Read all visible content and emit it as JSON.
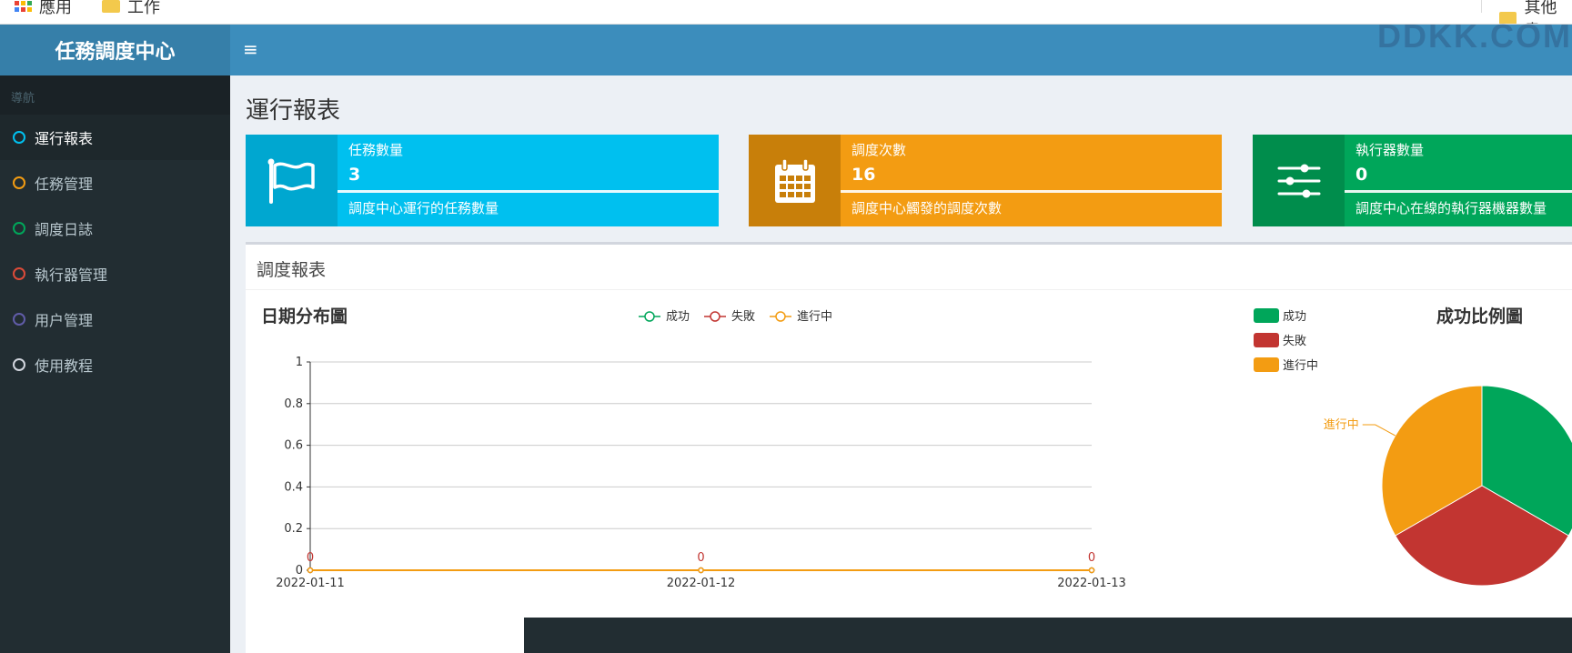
{
  "bookmarks": {
    "apps_label": "應用",
    "work_label": "工作",
    "other_label": "其他書"
  },
  "header": {
    "logo": "任務調度中心",
    "toggle_icon": "≡",
    "watermark": "DDKK.COM"
  },
  "sidebar": {
    "header": "導航",
    "items": [
      {
        "label": "運行報表",
        "color": "#00c0ef"
      },
      {
        "label": "任務管理",
        "color": "#f39c12"
      },
      {
        "label": "調度日誌",
        "color": "#00a65a"
      },
      {
        "label": "執行器管理",
        "color": "#dd4b39"
      },
      {
        "label": "用户管理",
        "color": "#605ca8"
      },
      {
        "label": "使用教程",
        "color": "#d2d6de"
      }
    ]
  },
  "page": {
    "title": "運行報表"
  },
  "info_boxes": [
    {
      "label": "任務數量",
      "number": "3",
      "desc": "調度中心運行的任務數量",
      "icon": "flag-icon",
      "color": "#00c0ef",
      "icon_bg": "#00a7d0"
    },
    {
      "label": "調度次數",
      "number": "16",
      "desc": "調度中心觸發的調度次數",
      "icon": "calendar-icon",
      "color": "#f39c12",
      "icon_bg": "#c87f0a"
    },
    {
      "label": "執行器數量",
      "number": "0",
      "desc": "調度中心在線的執行器機器數量",
      "icon": "sliders-icon",
      "color": "#00a65a",
      "icon_bg": "#008d4c"
    }
  ],
  "report": {
    "box_title": "調度報表"
  },
  "chart_data": [
    {
      "type": "line",
      "title": "日期分布圖",
      "x": [
        "2022-01-11",
        "2022-01-12",
        "2022-01-13"
      ],
      "series": [
        {
          "name": "成功",
          "values": [
            0,
            0,
            0
          ],
          "color": "#00a65a"
        },
        {
          "name": "失敗",
          "values": [
            0,
            0,
            0
          ],
          "color": "#c23531"
        },
        {
          "name": "進行中",
          "values": [
            0,
            0,
            0
          ],
          "color": "#f39c12"
        }
      ],
      "ylim": [
        0,
        1
      ],
      "yticks": [
        "0",
        "0.2",
        "0.4",
        "0.6",
        "0.8",
        "1"
      ],
      "data_labels": [
        "0",
        "0",
        "0"
      ],
      "grid": true,
      "legend": "top-center"
    },
    {
      "type": "pie",
      "title": "成功比例圖",
      "categories": [
        "成功",
        "失敗",
        "進行中"
      ],
      "values": [
        1,
        1,
        1
      ],
      "colors": [
        "#00a65a",
        "#c23531",
        "#f39c12"
      ],
      "slice_label": "進行中",
      "legend": "top-left"
    }
  ]
}
